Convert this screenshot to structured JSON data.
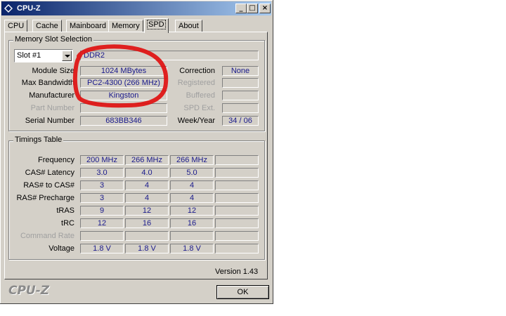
{
  "window": {
    "title": "CPU-Z",
    "controls": {
      "minimize": "_",
      "maximize": "□",
      "close": "×"
    }
  },
  "tabs": [
    {
      "label": "CPU",
      "active": false
    },
    {
      "label": "Cache",
      "active": false
    },
    {
      "label": "Mainboard",
      "active": false
    },
    {
      "label": "Memory",
      "active": false
    },
    {
      "label": "SPD",
      "active": true
    },
    {
      "label": "About",
      "active": false
    }
  ],
  "memory_slot": {
    "group_title": "Memory Slot Selection",
    "slot_selected": "Slot #1",
    "memory_type": "DDR2",
    "fields": {
      "module_size": {
        "label": "Module Size",
        "value": "1024 MBytes"
      },
      "max_bandwidth": {
        "label": "Max Bandwidth",
        "value": "PC2-4300 (266 MHz)"
      },
      "manufacturer": {
        "label": "Manufacturer",
        "value": "Kingston"
      },
      "part_number": {
        "label": "Part Number",
        "value": ""
      },
      "serial_number": {
        "label": "Serial Number",
        "value": "683BB346"
      },
      "correction": {
        "label": "Correction",
        "value": "None"
      },
      "registered": {
        "label": "Registered",
        "value": ""
      },
      "buffered": {
        "label": "Buffered",
        "value": ""
      },
      "spd_ext": {
        "label": "SPD Ext.",
        "value": ""
      },
      "week_year": {
        "label": "Week/Year",
        "value": "34 / 06"
      }
    }
  },
  "timings": {
    "group_title": "Timings Table",
    "rows": [
      {
        "label": "Frequency",
        "dim": false,
        "values": [
          "200 MHz",
          "266 MHz",
          "266 MHz",
          ""
        ]
      },
      {
        "label": "CAS# Latency",
        "dim": false,
        "values": [
          "3.0",
          "4.0",
          "5.0",
          ""
        ]
      },
      {
        "label": "RAS# to CAS#",
        "dim": false,
        "values": [
          "3",
          "4",
          "4",
          ""
        ]
      },
      {
        "label": "RAS# Precharge",
        "dim": false,
        "values": [
          "3",
          "4",
          "4",
          ""
        ]
      },
      {
        "label": "tRAS",
        "dim": false,
        "values": [
          "9",
          "12",
          "12",
          ""
        ]
      },
      {
        "label": "tRC",
        "dim": false,
        "values": [
          "12",
          "16",
          "16",
          ""
        ]
      },
      {
        "label": "Command Rate",
        "dim": true,
        "values": [
          "",
          "",
          "",
          ""
        ]
      },
      {
        "label": "Voltage",
        "dim": false,
        "values": [
          "1.8 V",
          "1.8 V",
          "1.8 V",
          ""
        ]
      }
    ]
  },
  "footer": {
    "version": "Version 1.43",
    "logo": "CPU-Z",
    "ok_label": "OK"
  },
  "colors": {
    "value_text": "#1a1a8c",
    "annotation_stroke": "#e01010",
    "title_gradient_start": "#0a246a",
    "title_gradient_end": "#a6caf0"
  }
}
